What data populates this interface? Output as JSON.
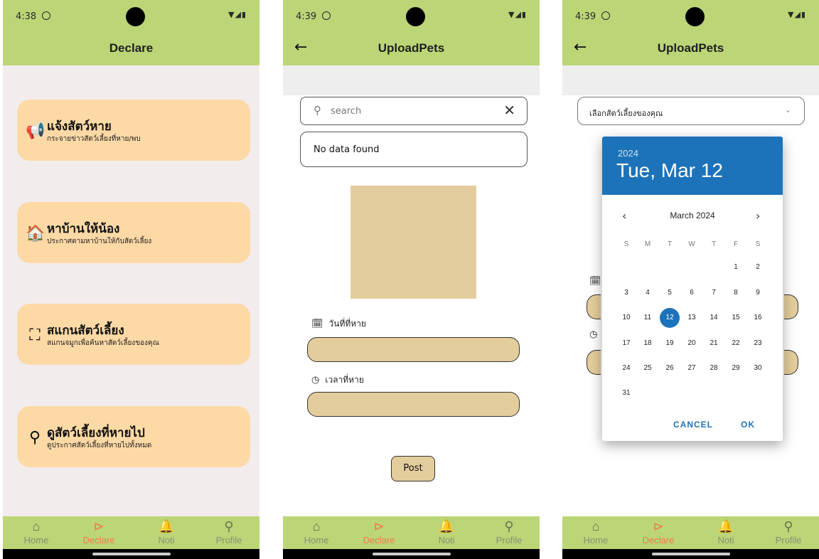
{
  "status": {
    "time1": "4:38",
    "time2": "4:39",
    "time3": "4:39",
    "icons": "▼◢▮"
  },
  "nav": [
    {
      "label": "Home",
      "icon": "⌂"
    },
    {
      "label": "Declare",
      "icon": "⊳"
    },
    {
      "label": "Noti",
      "icon": "🔔"
    },
    {
      "label": "Profile",
      "icon": "⚲"
    }
  ],
  "screen1": {
    "title": "Declare",
    "cards": [
      {
        "icon": "📢",
        "title": "แจ้งสัตว์หาย",
        "subtitle": "กระจายข่าวสัตว์เลี้ยงที่หาย/พบ"
      },
      {
        "icon": "🏠",
        "title": "หาบ้านให้น้อง",
        "subtitle": "ประกาศตามหาบ้านให้กับสัตว์เลี้ยง"
      },
      {
        "icon": "⛶",
        "title": "สแกนสัตว์เลี้ยง",
        "subtitle": "สแกนจมูกเพื่อค้นหาสัตว์เลี้ยงของคุณ"
      },
      {
        "icon": "⚲",
        "title": "ดูสัตว์เลี้ยงที่หายไป",
        "subtitle": "ดูประกาศสัตว์เลี้ยงที่หายไปทั้งหมด"
      }
    ]
  },
  "screen2": {
    "title": "UploadPets",
    "search_placeholder": "search",
    "no_data": "No data found",
    "date_label": "วันที่ที่หาย",
    "time_label": "เวลาที่หาย",
    "post_label": "Post"
  },
  "screen3": {
    "title": "UploadPets",
    "dropdown_text": "เลือกสัตว์เลี้ยงของคุณ",
    "picker": {
      "year": "2024",
      "date": "Tue, Mar 12",
      "month_label": "March 2024",
      "weekdays": [
        "S",
        "M",
        "T",
        "W",
        "T",
        "F",
        "S"
      ],
      "selected_day": 12,
      "cancel": "CANCEL",
      "ok": "OK"
    }
  },
  "colors": {
    "bar": "#bcd577",
    "card": "#fdd9a6",
    "field": "#e4cd9c",
    "accent": "#1d73b9",
    "nav_active": "#f07b4a"
  }
}
